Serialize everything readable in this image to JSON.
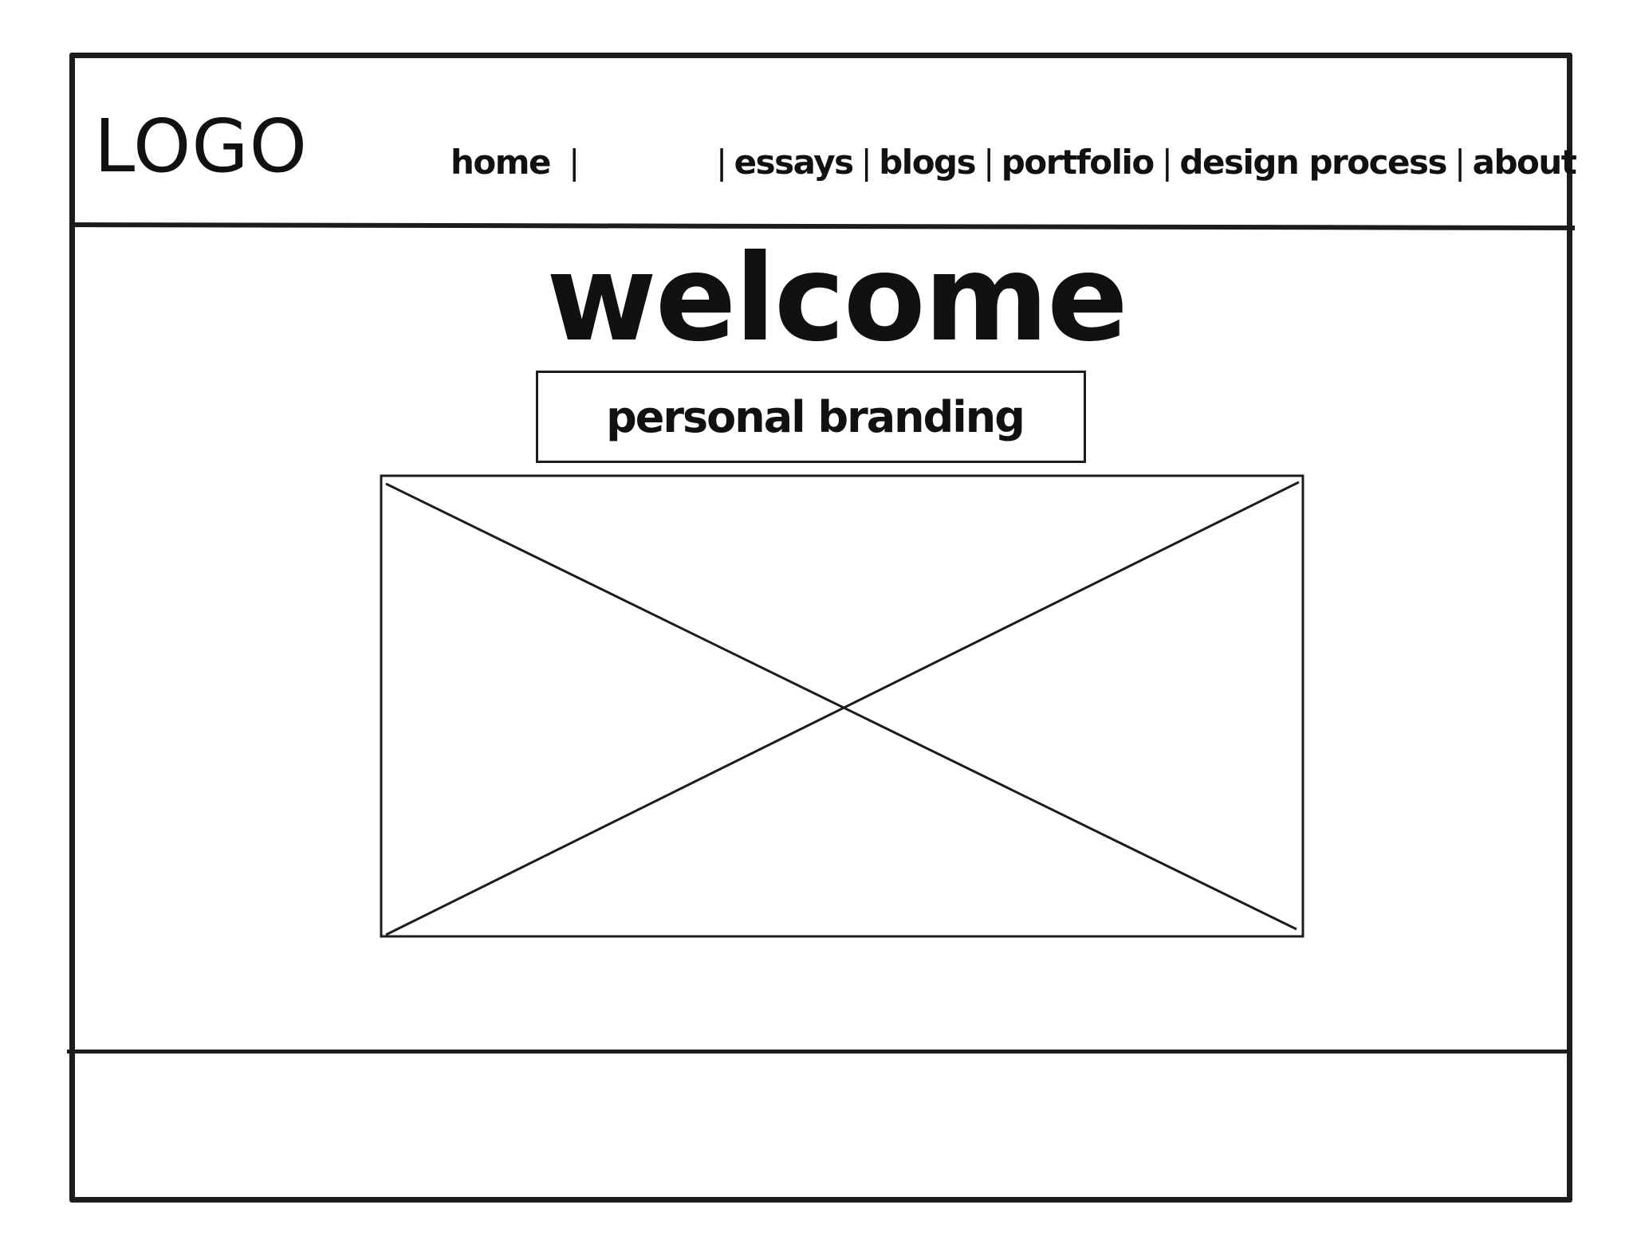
{
  "header": {
    "logo": "LOGO",
    "nav": {
      "home": "home",
      "items": [
        "essays",
        "blogs",
        "portfolio",
        "design process",
        "about"
      ],
      "separator": "|"
    }
  },
  "main": {
    "title": "welcome",
    "subtitle": "personal branding",
    "hero_image": "image-placeholder-icon"
  }
}
